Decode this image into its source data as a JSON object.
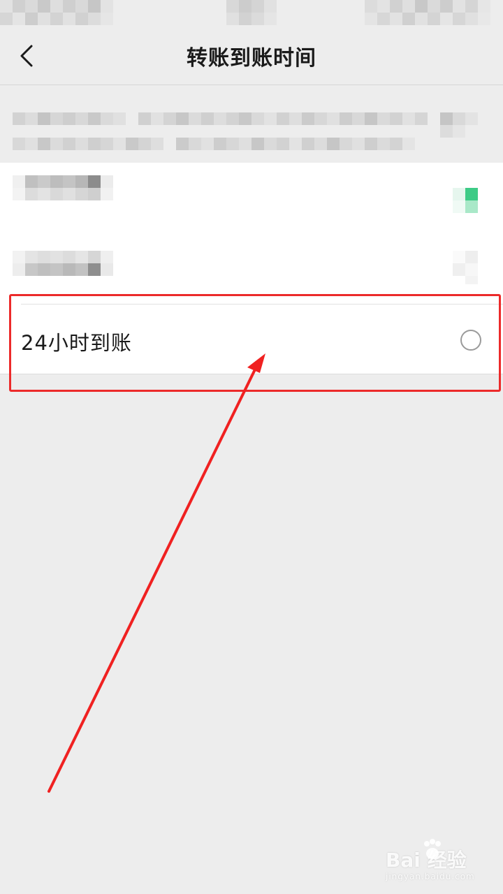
{
  "nav": {
    "title": "转账到账时间",
    "back_icon": "chevron-left-icon"
  },
  "options": {
    "items": [
      {
        "label": "24小时到账",
        "selected": false,
        "control": "radio-unchecked-icon"
      }
    ]
  },
  "annotation": {
    "highlight_color": "#ec2a2a",
    "arrow_color": "#f02121"
  },
  "watermark": {
    "brand": "Bai   经验",
    "url": "jingyan.baidu.com"
  },
  "colors": {
    "background": "#ededed",
    "card": "#ffffff",
    "text": "#1a1a1a",
    "accent_green": "#3dcb86"
  }
}
